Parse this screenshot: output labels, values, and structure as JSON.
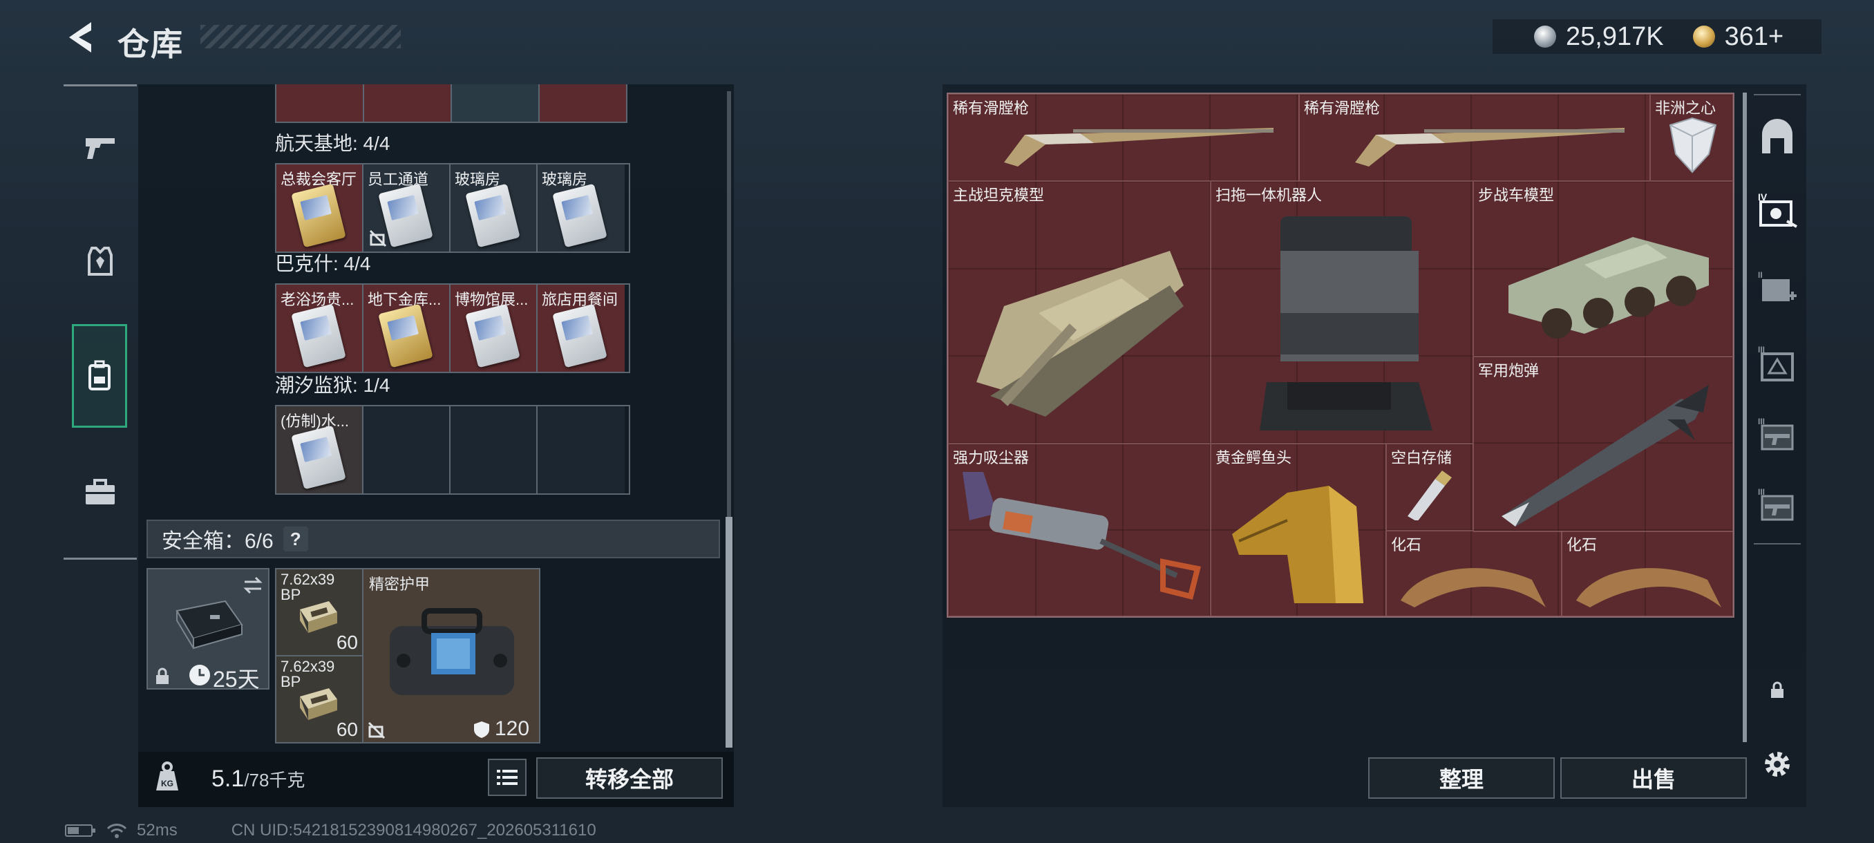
{
  "header": {
    "title": "仓库",
    "currency_silver": "25,917K",
    "currency_gold": "361+"
  },
  "sidebar": {
    "items": [
      {
        "name": "weapon-tab",
        "icon": "gun-icon"
      },
      {
        "name": "armor-tab",
        "icon": "armor-icon"
      },
      {
        "name": "backpack-tab",
        "icon": "backpack-icon"
      },
      {
        "name": "toolbox-tab",
        "icon": "briefcase-icon"
      }
    ]
  },
  "key_groups": [
    {
      "title": "航天基地: 4/4",
      "cells": [
        {
          "label": "总裁会客厅",
          "card": "gold",
          "bg": "red",
          "locked": false
        },
        {
          "label": "员工通道",
          "card": "silver",
          "bg": "dark",
          "locked": true
        },
        {
          "label": "玻璃房",
          "card": "silver",
          "bg": "dark",
          "locked": false
        },
        {
          "label": "玻璃房",
          "card": "silver",
          "bg": "dark",
          "locked": false
        }
      ]
    },
    {
      "title": "巴克什: 4/4",
      "cells": [
        {
          "label": "老浴场贵...",
          "card": "silver",
          "bg": "red",
          "locked": false
        },
        {
          "label": "地下金库...",
          "card": "gold",
          "bg": "red",
          "locked": false
        },
        {
          "label": "博物馆展...",
          "card": "silver",
          "bg": "red",
          "locked": false
        },
        {
          "label": "旅店用餐间",
          "card": "silver",
          "bg": "red",
          "locked": false
        }
      ]
    },
    {
      "title": "潮汐监狱: 1/4",
      "cells": [
        {
          "label": "(仿制)水...",
          "card": "silver",
          "bg": "dark",
          "locked": false
        },
        {
          "label": "",
          "card": "",
          "bg": "empty",
          "locked": false
        },
        {
          "label": "",
          "card": "",
          "bg": "empty",
          "locked": false
        },
        {
          "label": "",
          "card": "",
          "bg": "empty",
          "locked": false
        }
      ]
    }
  ],
  "safe_box": {
    "title": "安全箱：6/6",
    "help": "?",
    "duration": "25天",
    "items": [
      {
        "label": "7.62x39 BP",
        "count": "60"
      },
      {
        "label": "7.62x39 BP",
        "count": "60"
      },
      {
        "label": "精密护甲",
        "durability": "120"
      }
    ]
  },
  "bottom_left": {
    "weight_current": "5.1",
    "weight_max": "/78千克",
    "transfer_all": "转移全部"
  },
  "stash_items": [
    {
      "label": "稀有滑膛枪"
    },
    {
      "label": "稀有滑膛枪"
    },
    {
      "label": "非洲之心"
    },
    {
      "label": "主战坦克模型"
    },
    {
      "label": "扫拖一体机器人"
    },
    {
      "label": "步战车模型"
    },
    {
      "label": "军用炮弹"
    },
    {
      "label": "强力吸尘器"
    },
    {
      "label": "黄金鳄鱼头"
    },
    {
      "label": "空白存储"
    },
    {
      "label": "化石"
    },
    {
      "label": "化石"
    }
  ],
  "bottom_right": {
    "sort": "整理",
    "sell": "出售"
  },
  "status_bar": {
    "ping": "52ms",
    "uid": "CN UID:54218152390814980267_202605311610"
  }
}
